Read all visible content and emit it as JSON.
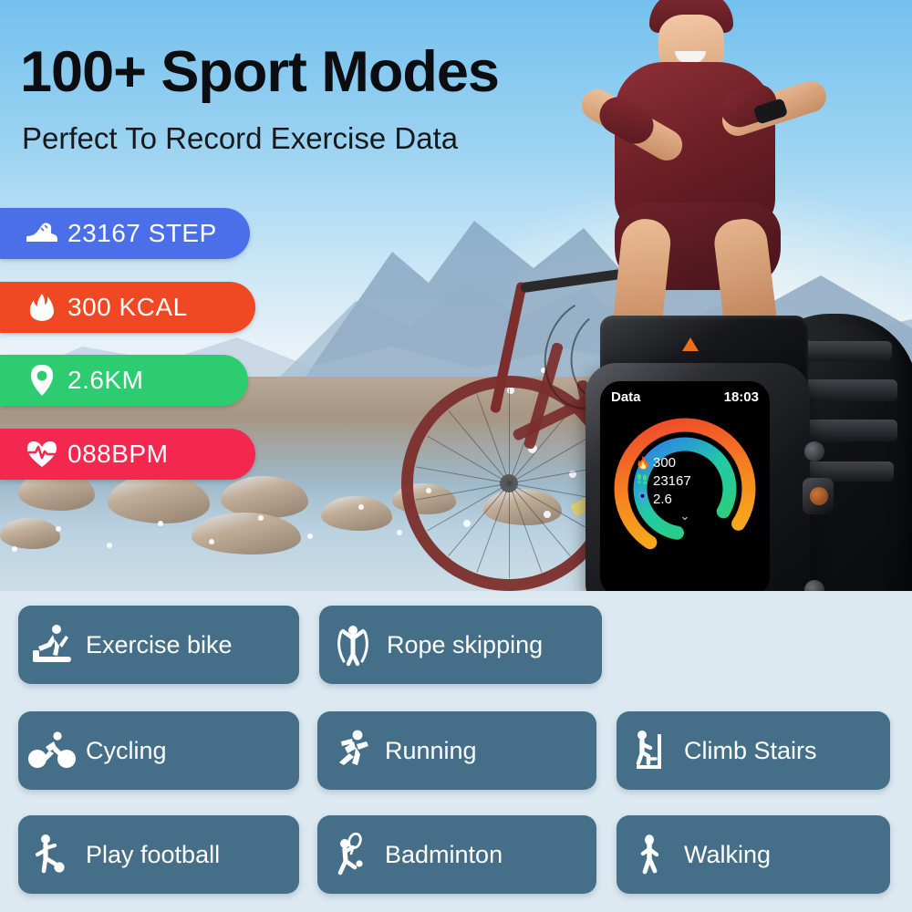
{
  "header": {
    "title": "100+ Sport Modes",
    "subtitle": "Perfect To Record Exercise Data"
  },
  "metrics": [
    {
      "value": "23167 STEP",
      "icon": "shoe-icon",
      "color": "#4a6fe8"
    },
    {
      "value": "300 KCAL",
      "icon": "flame-icon",
      "color": "#f04822"
    },
    {
      "value": "2.6KM",
      "icon": "location-pin-icon",
      "color": "#2ecc71"
    },
    {
      "value": "088BPM",
      "icon": "heartbeat-icon",
      "color": "#f4274f"
    }
  ],
  "watch": {
    "screen_label": "Data",
    "time": "18:03",
    "stats": [
      {
        "icon": "flame-icon",
        "value": "300",
        "color": "#f4712a"
      },
      {
        "icon": "footsteps-icon",
        "value": "23167",
        "color": "#3ddc7f"
      },
      {
        "icon": "location-pin-icon",
        "value": "2.6",
        "color": "#4aa3f0"
      }
    ],
    "expand_icon": "chevron-down-icon",
    "rings": {
      "outer_colors": [
        "#f03b2f",
        "#f5881f",
        "#f7c51c"
      ],
      "inner_colors": [
        "#2fd06b",
        "#22c9a8",
        "#2f7bef"
      ]
    },
    "accent_color": "#e8701d"
  },
  "sport_modes": [
    {
      "label": "Exercise bike",
      "icon": "treadmill-icon"
    },
    {
      "label": "Rope skipping",
      "icon": "rope-skipping-icon"
    },
    {
      "label": "Cycling",
      "icon": "cyclist-icon"
    },
    {
      "label": "Running",
      "icon": "runner-icon"
    },
    {
      "label": "Climb Stairs",
      "icon": "stair-climber-icon"
    },
    {
      "label": "Play football",
      "icon": "football-player-icon"
    },
    {
      "label": "Badminton",
      "icon": "badminton-player-icon"
    },
    {
      "label": "Walking",
      "icon": "walking-person-icon"
    }
  ],
  "theme": {
    "chip_color": "#456f88",
    "section_bg": "#dde9f1",
    "sky_color": "#74c1ed"
  }
}
